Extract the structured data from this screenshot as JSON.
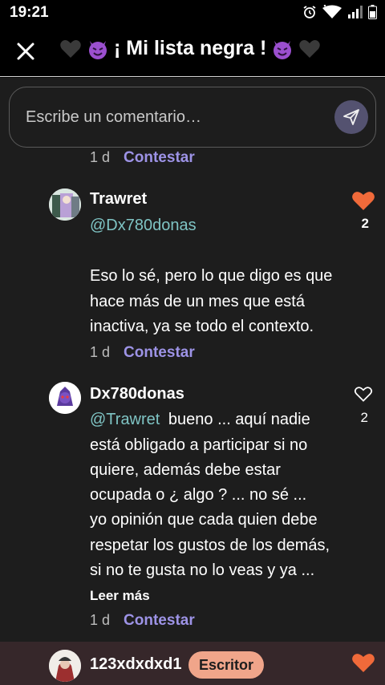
{
  "status_bar": {
    "time": "19:21"
  },
  "header": {
    "title": "¡ Mi lista negra !"
  },
  "comment_input": {
    "placeholder": "Escribe un comentario…"
  },
  "colors": {
    "accent": "#9d93e6",
    "like_active": "#f06a3a",
    "mention": "#7fc4c4",
    "badge": "#f0a58a"
  },
  "top_meta": {
    "age": "1 d",
    "reply": "Contestar"
  },
  "comments": [
    {
      "username": "Trawret",
      "mention": "@Dx780donas",
      "lines": [
        "Eso lo sé, pero lo que digo es que",
        "hace más de un mes que está",
        "inactiva, ya se todo el contexto."
      ],
      "age": "1 d",
      "reply": "Contestar",
      "likes": "2",
      "liked": true
    },
    {
      "username": "Dx780donas",
      "mention": "@Trawret",
      "first_line_rest": "bueno ... aquí nadie",
      "lines": [
        "está obligado a participar si no",
        "quiere, además debe estar",
        "ocupada o ¿ algo ? ... no sé ...",
        "yo opinión que cada quien debe",
        "respetar los gustos de los demás,",
        "si no te gusta no lo veas y ya ..."
      ],
      "read_more": "Leer más",
      "age": "1 d",
      "reply": "Contestar",
      "likes": "2",
      "liked": false
    },
    {
      "username": "123xdxdxd1",
      "badge": "Escritor",
      "liked": true
    }
  ]
}
